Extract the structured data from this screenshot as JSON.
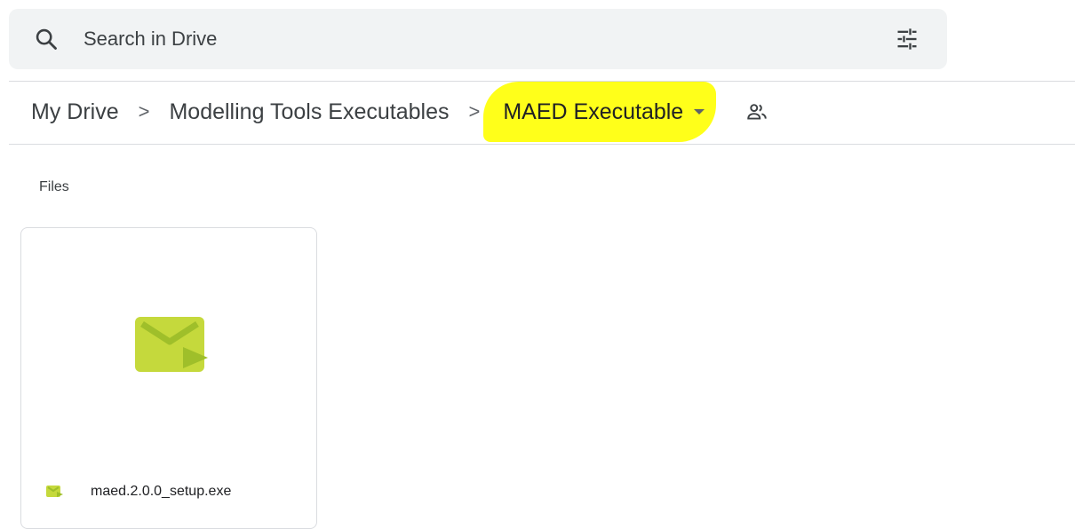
{
  "search": {
    "placeholder": "Search in Drive"
  },
  "icons": {
    "search": "search-icon",
    "filter": "tune-sliders-icon",
    "shared": "people-icon",
    "caret": "caret-down-icon",
    "file": "exe-file-icon"
  },
  "breadcrumb": {
    "items": [
      "My Drive",
      "Modelling Tools Executables"
    ],
    "separator": ">",
    "current": "MAED Executable"
  },
  "section": {
    "label": "Files"
  },
  "files": [
    {
      "name": "maed.2.0.0_setup.exe"
    }
  ],
  "colors": {
    "highlight": "#ffff1a",
    "file_icon": "#c5d93c",
    "file_icon_dark": "#9fbf2a",
    "search_bg": "#f1f3f4"
  }
}
